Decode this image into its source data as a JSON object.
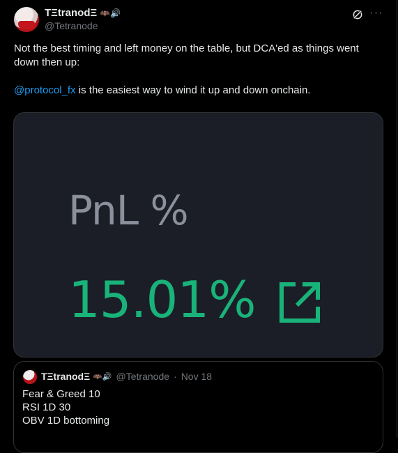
{
  "author": {
    "display_name": "TΞtranodΞ",
    "badges": "🦇🔊",
    "handle": "@Tetranode"
  },
  "icons": {
    "grok": "grok-icon",
    "more": "more-icon",
    "external": "external-link-icon"
  },
  "tweet": {
    "line1": "Not the best timing and left money on the table, but DCA'ed as things went down then up:",
    "mention": "@protocol_fx",
    "line2_rest": " is the easiest way to wind it up and down onchain."
  },
  "media": {
    "label": "PnL %",
    "value": "15.01%",
    "value_color": "#19b37a",
    "background": "#1c1e27"
  },
  "quote": {
    "display_name": "TΞtranodΞ",
    "badges": "🦇🔊",
    "handle": "@Tetranode",
    "separator": "·",
    "date": "Nov 18",
    "lines": [
      "Fear & Greed 10",
      "RSI 1D 30",
      "OBV 1D bottoming"
    ]
  },
  "colors": {
    "background": "#000000",
    "text": "#e7e9ea",
    "muted": "#71767b",
    "link": "#1d9bf0",
    "border": "#2f3336"
  }
}
